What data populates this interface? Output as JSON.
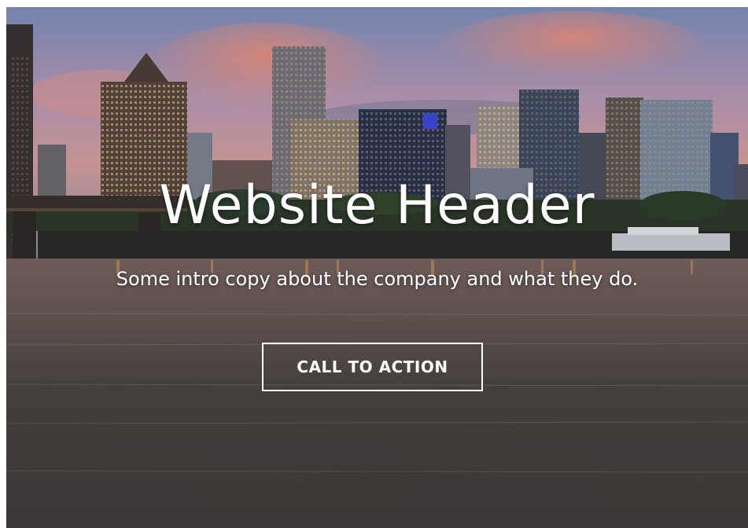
{
  "hero": {
    "headline": "Website Header",
    "intro": "Some intro copy about the company and what they do.",
    "cta_label": "CALL TO ACTION"
  },
  "colors": {
    "text": "#ffffff",
    "button_border": "#ffffff",
    "sky_top": "#8fa3c6",
    "sunset": "#e8857a",
    "water": "#4a4644"
  }
}
